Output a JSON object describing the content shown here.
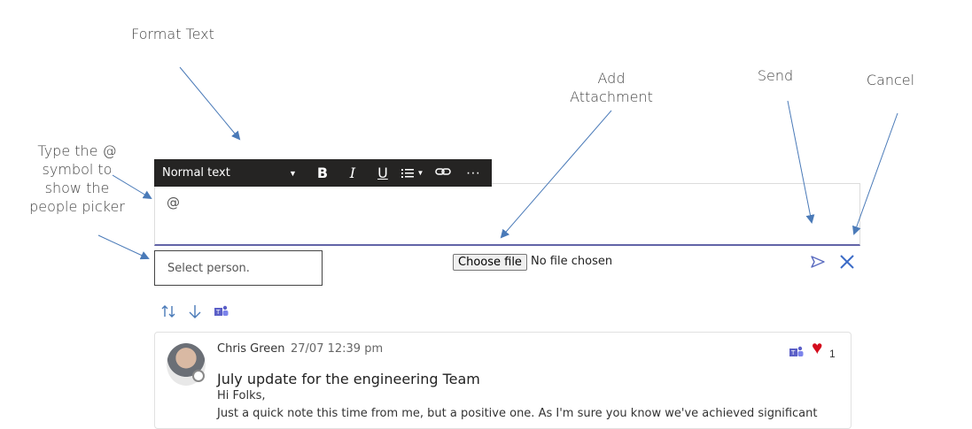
{
  "annotations": {
    "format_text": "Format Text",
    "add_attachment_line1": "Add",
    "add_attachment_line2": "Attachment",
    "send": "Send",
    "cancel": "Cancel",
    "people_picker_line1": "Type the @",
    "people_picker_line2": "symbol to",
    "people_picker_line3": "show the",
    "people_picker_line4": "people picker"
  },
  "toolbar": {
    "style_value": "Normal text",
    "bold_label": "B",
    "italic_label": "I",
    "underline_label": "U",
    "more_label": "···"
  },
  "editor": {
    "content": "@"
  },
  "person_picker": {
    "placeholder": "Select person."
  },
  "attachment": {
    "button_label": "Choose file",
    "status": "No file chosen"
  },
  "post": {
    "author": "Chris Green",
    "timestamp": "27/07 12:39 pm",
    "subject": "July update for the engineering Team",
    "greeting": "Hi Folks,",
    "body_line": "Just a quick note this time from me, but a positive one. As I'm sure you know we've achieved significant",
    "like_count": "1"
  },
  "colors": {
    "accent": "#6264a7",
    "toolbar_bg": "#252423",
    "arrow": "#4a7ab8",
    "heart": "#d40c1c"
  }
}
